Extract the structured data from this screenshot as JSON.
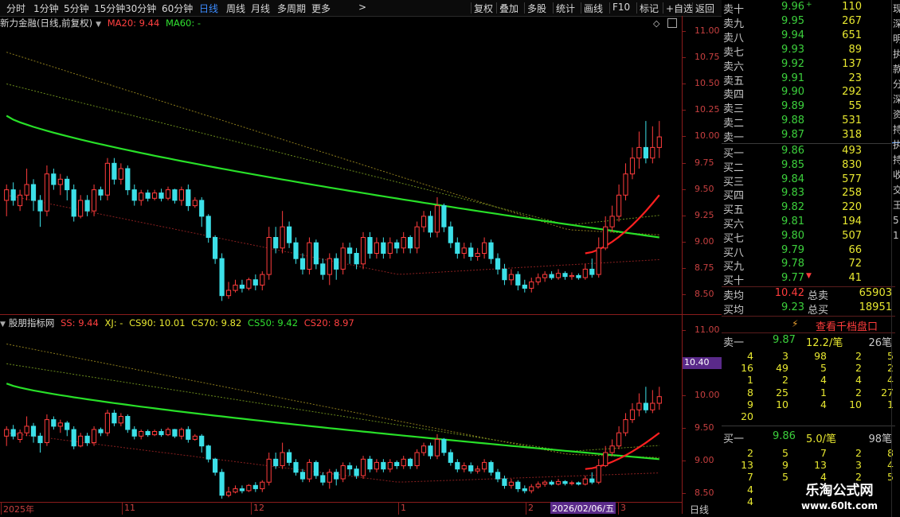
{
  "toolbar": {
    "tabs": [
      "分时",
      "1分钟",
      "5分钟",
      "15分钟",
      "30分钟",
      "60分钟",
      "日线",
      "周线",
      "月线",
      "多周期",
      "更多"
    ],
    "more_arrow": ">",
    "active": "日线",
    "right_buttons": [
      "复权",
      "叠加",
      "多股",
      "统计",
      "画线",
      "F10",
      "标记",
      "+自选",
      "返回"
    ]
  },
  "main_chart": {
    "stock_name": "新力金融(日线,前复权)",
    "ma20_label": "MA20: 9.44",
    "ma60_label": "MA60: -",
    "y_ticks": [
      "11.00",
      "10.75",
      "10.50",
      "10.25",
      "10.00",
      "9.75",
      "9.50",
      "9.25",
      "9.00",
      "8.75",
      "8.50"
    ]
  },
  "sub_chart": {
    "name": "股朋指标网",
    "ss_label": "SS: 9.44",
    "xj_label": "XJ: -",
    "cs90_label": "CS90: 10.01",
    "cs70_label": "CS70: 9.82",
    "cs50_label": "CS50: 9.42",
    "cs20_label": "CS20: 8.97",
    "y_ticks": [
      "11.00",
      "10.50",
      "10.00",
      "9.50",
      "9.00",
      "8.50"
    ],
    "cursor_value": "10.40"
  },
  "date_axis": {
    "labels": [
      "2025年",
      "11",
      "12",
      "1",
      "2",
      "3"
    ],
    "cursor_date": "2026/02/06/五",
    "period": "日线"
  },
  "order_book": {
    "sells": [
      {
        "label": "卖十",
        "price": "9.96",
        "mark": "+",
        "vol": "110"
      },
      {
        "label": "卖九",
        "price": "9.95",
        "mark": "",
        "vol": "267"
      },
      {
        "label": "卖八",
        "price": "9.94",
        "mark": "",
        "vol": "651"
      },
      {
        "label": "卖七",
        "price": "9.93",
        "mark": "",
        "vol": "89"
      },
      {
        "label": "卖六",
        "price": "9.92",
        "mark": "",
        "vol": "137"
      },
      {
        "label": "卖五",
        "price": "9.91",
        "mark": "",
        "vol": "23"
      },
      {
        "label": "卖四",
        "price": "9.90",
        "mark": "",
        "vol": "292"
      },
      {
        "label": "卖三",
        "price": "9.89",
        "mark": "",
        "vol": "55"
      },
      {
        "label": "卖二",
        "price": "9.88",
        "mark": "",
        "vol": "531"
      },
      {
        "label": "卖一",
        "price": "9.87",
        "mark": "",
        "vol": "318"
      }
    ],
    "buys": [
      {
        "label": "买一",
        "price": "9.86",
        "mark": "",
        "vol": "493"
      },
      {
        "label": "买二",
        "price": "9.85",
        "mark": "",
        "vol": "830"
      },
      {
        "label": "买三",
        "price": "9.84",
        "mark": "",
        "vol": "577"
      },
      {
        "label": "买四",
        "price": "9.83",
        "mark": "",
        "vol": "258"
      },
      {
        "label": "买五",
        "price": "9.82",
        "mark": "",
        "vol": "220"
      },
      {
        "label": "买六",
        "price": "9.81",
        "mark": "",
        "vol": "194"
      },
      {
        "label": "买七",
        "price": "9.80",
        "mark": "",
        "vol": "507"
      },
      {
        "label": "买八",
        "price": "9.79",
        "mark": "",
        "vol": "66"
      },
      {
        "label": "买九",
        "price": "9.78",
        "mark": "",
        "vol": "72"
      },
      {
        "label": "买十",
        "price": "9.77",
        "mark": "▼",
        "vol": "41"
      }
    ],
    "sell_avg_label": "卖均",
    "sell_avg": "10.42",
    "total_sell_label": "总卖",
    "total_sell": "65903",
    "buy_avg_label": "买均",
    "buy_avg": "9.23",
    "total_buy_label": "总买",
    "total_buy": "18951",
    "bolt": "⚡",
    "depth_button": "查看千档盘口"
  },
  "queue": {
    "sell1": {
      "label": "卖一",
      "price": "9.87",
      "per": "12.2/笔",
      "count": "26笔"
    },
    "sell_rows": [
      [
        "4",
        "3",
        "98",
        "2",
        "5"
      ],
      [
        "16",
        "49",
        "5",
        "2",
        "2"
      ],
      [
        "1",
        "2",
        "4",
        "4",
        "4"
      ],
      [
        "8",
        "25",
        "1",
        "2",
        "27"
      ],
      [
        "9",
        "10",
        "4",
        "10",
        "1"
      ],
      [
        "20",
        "",
        "",
        "",
        ""
      ]
    ],
    "buy1": {
      "label": "买一",
      "price": "9.86",
      "per": "5.0/笔",
      "count": "98笔"
    },
    "buy_rows": [
      [
        "2",
        "5",
        "7",
        "2",
        "8"
      ],
      [
        "13",
        "9",
        "13",
        "3",
        "4"
      ],
      [
        "7",
        "5",
        "4",
        "2",
        "5"
      ],
      [
        "4",
        "",
        "",
        "",
        ""
      ],
      [
        "4",
        "",
        "",
        "",
        ""
      ]
    ]
  },
  "side_strip": [
    "现",
    "深",
    "明",
    "执",
    "款",
    "分",
    "深",
    "资",
    "持",
    "执",
    "持",
    "收",
    "交",
    "王",
    "5",
    "1"
  ],
  "watermark": {
    "name": "乐淘公式网",
    "url": "www.60lt.com"
  },
  "chart_data": {
    "type": "candlestick",
    "title": "新力金融(日线,前复权)",
    "ylim": [
      8.45,
      11.05
    ],
    "x_labels": [
      "2025年",
      "11",
      "12",
      "1",
      "2",
      "3"
    ],
    "candles": [
      [
        9.45,
        9.55,
        9.3,
        9.6
      ],
      [
        9.55,
        9.45,
        9.4,
        9.62
      ],
      [
        9.4,
        9.5,
        9.35,
        9.55
      ],
      [
        9.5,
        9.6,
        9.45,
        9.75
      ],
      [
        9.6,
        9.45,
        9.35,
        9.65
      ],
      [
        9.45,
        9.35,
        9.2,
        9.5
      ],
      [
        9.35,
        9.7,
        9.3,
        9.78
      ],
      [
        9.7,
        9.6,
        9.55,
        9.75
      ],
      [
        9.6,
        9.65,
        9.5,
        9.7
      ],
      [
        9.65,
        9.55,
        9.45,
        9.68
      ],
      [
        9.55,
        9.3,
        9.25,
        9.6
      ],
      [
        9.3,
        9.45,
        9.28,
        9.5
      ],
      [
        9.45,
        9.35,
        9.3,
        9.5
      ],
      [
        9.35,
        9.55,
        9.3,
        9.6
      ],
      [
        9.55,
        9.5,
        9.45,
        9.58
      ],
      [
        9.5,
        9.8,
        9.45,
        9.85
      ],
      [
        9.8,
        9.65,
        9.6,
        9.85
      ],
      [
        9.65,
        9.75,
        9.6,
        9.8
      ],
      [
        9.75,
        9.55,
        9.5,
        9.78
      ],
      [
        9.55,
        9.45,
        9.4,
        9.6
      ],
      [
        9.45,
        9.52,
        9.4,
        9.55
      ],
      [
        9.52,
        9.47,
        9.44,
        9.55
      ],
      [
        9.47,
        9.52,
        9.45,
        9.55
      ],
      [
        9.52,
        9.47,
        9.44,
        9.56
      ],
      [
        9.47,
        9.55,
        9.45,
        9.58
      ],
      [
        9.55,
        9.45,
        9.42,
        9.56
      ],
      [
        9.45,
        9.55,
        9.4,
        9.58
      ],
      [
        9.55,
        9.4,
        9.35,
        9.6
      ],
      [
        9.4,
        9.45,
        9.38,
        9.48
      ],
      [
        9.45,
        9.3,
        9.2,
        9.48
      ],
      [
        9.3,
        9.1,
        9.05,
        9.32
      ],
      [
        9.1,
        8.9,
        8.85,
        9.12
      ],
      [
        8.9,
        8.55,
        8.5,
        8.95
      ],
      [
        8.55,
        8.6,
        8.52,
        8.68
      ],
      [
        8.6,
        8.65,
        8.58,
        8.7
      ],
      [
        8.65,
        8.62,
        8.58,
        8.7
      ],
      [
        8.62,
        8.7,
        8.6,
        8.72
      ],
      [
        8.7,
        8.65,
        8.6,
        8.75
      ],
      [
        8.65,
        8.75,
        8.6,
        8.78
      ],
      [
        8.75,
        9.1,
        8.7,
        9.2
      ],
      [
        9.1,
        9.0,
        8.95,
        9.2
      ],
      [
        9.0,
        9.2,
        8.95,
        9.35
      ],
      [
        9.2,
        9.05,
        9.0,
        9.25
      ],
      [
        9.05,
        8.9,
        8.85,
        9.1
      ],
      [
        8.9,
        8.8,
        8.75,
        8.95
      ],
      [
        8.8,
        9.05,
        8.75,
        9.1
      ],
      [
        9.05,
        8.85,
        8.8,
        9.08
      ],
      [
        8.85,
        8.75,
        8.7,
        8.9
      ],
      [
        8.75,
        8.9,
        8.65,
        8.95
      ],
      [
        8.9,
        8.8,
        8.7,
        8.95
      ],
      [
        8.8,
        9.0,
        8.75,
        9.05
      ],
      [
        9.0,
        8.95,
        8.85,
        9.05
      ],
      [
        8.95,
        8.85,
        8.8,
        9.0
      ],
      [
        8.85,
        9.1,
        8.8,
        9.15
      ],
      [
        9.1,
        8.95,
        8.9,
        9.15
      ],
      [
        8.95,
        9.05,
        8.9,
        9.1
      ],
      [
        9.05,
        8.95,
        8.9,
        9.1
      ],
      [
        8.95,
        9.05,
        8.9,
        9.1
      ],
      [
        9.05,
        9.0,
        8.95,
        9.08
      ],
      [
        9.0,
        9.1,
        8.95,
        9.15
      ],
      [
        9.1,
        9.0,
        8.95,
        9.12
      ],
      [
        9.0,
        9.2,
        8.95,
        9.25
      ],
      [
        9.2,
        9.3,
        9.15,
        9.35
      ],
      [
        9.3,
        9.15,
        9.1,
        9.35
      ],
      [
        9.15,
        9.4,
        9.1,
        9.48
      ],
      [
        9.4,
        9.2,
        9.15,
        9.42
      ],
      [
        9.2,
        9.05,
        9.0,
        9.25
      ],
      [
        9.05,
        8.95,
        8.9,
        9.1
      ],
      [
        8.95,
        9.0,
        8.9,
        9.05
      ],
      [
        9.0,
        8.92,
        8.88,
        9.05
      ],
      [
        8.92,
        8.95,
        8.88,
        9.0
      ],
      [
        8.95,
        9.05,
        8.9,
        9.1
      ],
      [
        9.05,
        8.9,
        8.85,
        9.08
      ],
      [
        8.9,
        8.8,
        8.75,
        8.95
      ],
      [
        8.8,
        8.7,
        8.65,
        8.85
      ],
      [
        8.7,
        8.75,
        8.65,
        8.8
      ],
      [
        8.75,
        8.65,
        8.6,
        8.78
      ],
      [
        8.65,
        8.62,
        8.58,
        8.7
      ],
      [
        8.62,
        8.68,
        8.58,
        8.72
      ],
      [
        8.68,
        8.72,
        8.65,
        8.76
      ],
      [
        8.72,
        8.75,
        8.68,
        8.78
      ],
      [
        8.75,
        8.72,
        8.7,
        8.78
      ],
      [
        8.72,
        8.76,
        8.7,
        8.8
      ],
      [
        8.76,
        8.73,
        8.7,
        8.78
      ],
      [
        8.73,
        8.74,
        8.7,
        8.77
      ],
      [
        8.74,
        8.72,
        8.7,
        8.76
      ],
      [
        8.72,
        8.8,
        8.7,
        8.85
      ],
      [
        8.8,
        8.75,
        8.72,
        8.9
      ],
      [
        8.75,
        9.0,
        8.72,
        9.1
      ],
      [
        9.0,
        9.2,
        8.98,
        9.3
      ],
      [
        9.2,
        9.3,
        9.15,
        9.4
      ],
      [
        9.3,
        9.5,
        9.25,
        9.6
      ],
      [
        9.5,
        9.7,
        9.45,
        9.8
      ],
      [
        9.7,
        9.85,
        9.65,
        9.95
      ],
      [
        9.85,
        9.95,
        9.75,
        10.1
      ],
      [
        9.95,
        9.85,
        9.8,
        10.2
      ],
      [
        9.85,
        9.95,
        9.8,
        10.15
      ],
      [
        9.95,
        10.05,
        9.85,
        10.2
      ]
    ]
  }
}
